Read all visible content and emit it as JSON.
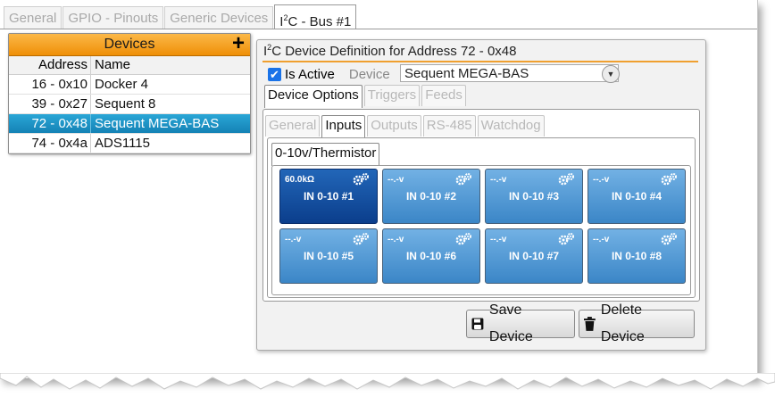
{
  "tabs": [
    "General",
    "GPIO - Pinouts",
    "Generic Devices",
    "I",
    "C - Bus #1"
  ],
  "device_list": {
    "header": "Devices",
    "add_icon": "plus-icon",
    "columns": [
      "Address",
      "Name"
    ],
    "rows": [
      {
        "address": "16 - 0x10",
        "name": "Docker 4"
      },
      {
        "address": "39 - 0x27",
        "name": "Sequent 8"
      },
      {
        "address": "72 - 0x48",
        "name": "Sequent MEGA-BAS"
      },
      {
        "address": "74 - 0x4a",
        "name": "ADS1115"
      }
    ]
  },
  "panel": {
    "title_pre": "I",
    "title_sup": "2",
    "title_post": "C Device Definition for Address 72 - 0x48",
    "is_active_label": "Is Active",
    "device_label": "Device",
    "device_value": "Sequent MEGA-BAS",
    "section_tabs": [
      "Device Options",
      "Triggers",
      "Feeds"
    ],
    "option_tabs": [
      "General",
      "Inputs",
      "Outputs",
      "RS-485",
      "Watchdog"
    ],
    "input_tab": "0-10v/Thermistor",
    "inputs": [
      {
        "name": "IN 0-10 #1",
        "value": "60.0kΩ"
      },
      {
        "name": "IN 0-10 #2",
        "value": "--.-v"
      },
      {
        "name": "IN 0-10 #3",
        "value": "--.-v"
      },
      {
        "name": "IN 0-10 #4",
        "value": "--.-v"
      },
      {
        "name": "IN 0-10 #5",
        "value": "--.-v"
      },
      {
        "name": "IN 0-10 #6",
        "value": "--.-v"
      },
      {
        "name": "IN 0-10 #7",
        "value": "--.-v"
      },
      {
        "name": "IN 0-10 #8",
        "value": "--.-v"
      }
    ],
    "save_label": "Save Device",
    "delete_label": "Delete Device"
  }
}
